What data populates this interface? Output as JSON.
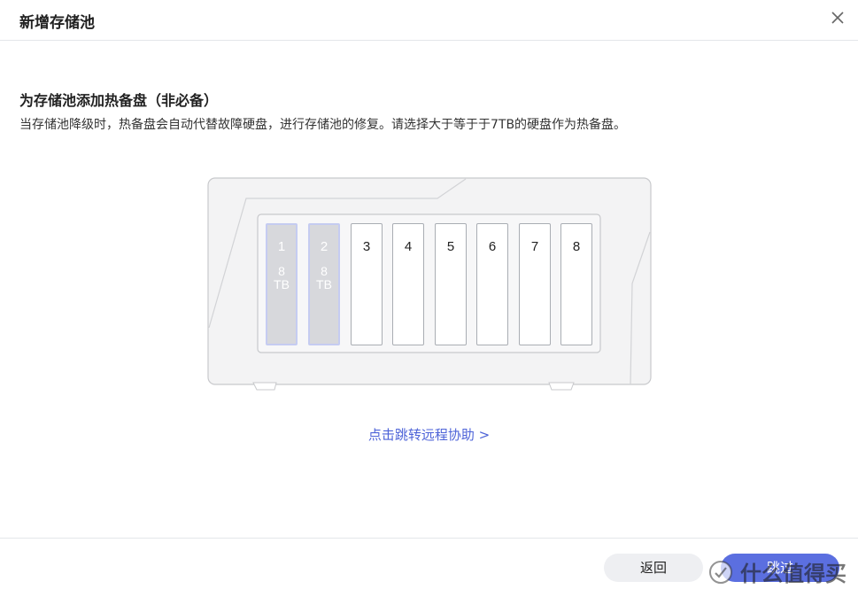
{
  "dialog": {
    "title": "新增存储池",
    "close_icon": "close-icon"
  },
  "section": {
    "title": "为存储池添加热备盘（非必备）",
    "description": "当存储池降级时，热备盘会自动代替故障硬盘，进行存储池的修复。请选择大于等于于7TB的硬盘作为热备盘。"
  },
  "bays": [
    {
      "number": "1",
      "capacity": "8",
      "unit": "TB",
      "used": true
    },
    {
      "number": "2",
      "capacity": "8",
      "unit": "TB",
      "used": true
    },
    {
      "number": "3",
      "capacity": "",
      "unit": "",
      "used": false
    },
    {
      "number": "4",
      "capacity": "",
      "unit": "",
      "used": false
    },
    {
      "number": "5",
      "capacity": "",
      "unit": "",
      "used": false
    },
    {
      "number": "6",
      "capacity": "",
      "unit": "",
      "used": false
    },
    {
      "number": "7",
      "capacity": "",
      "unit": "",
      "used": false
    },
    {
      "number": "8",
      "capacity": "",
      "unit": "",
      "used": false
    }
  ],
  "remote_link": "点击跳转远程协助 >",
  "footer": {
    "back_label": "返回",
    "skip_label": "跳过"
  },
  "watermark": {
    "text": "什么值得买"
  },
  "colors": {
    "accent": "#5b6fe0",
    "link": "#4d63d8",
    "used_bay_fill": "#d7d8dc",
    "used_bay_border": "#c5ccf1"
  }
}
